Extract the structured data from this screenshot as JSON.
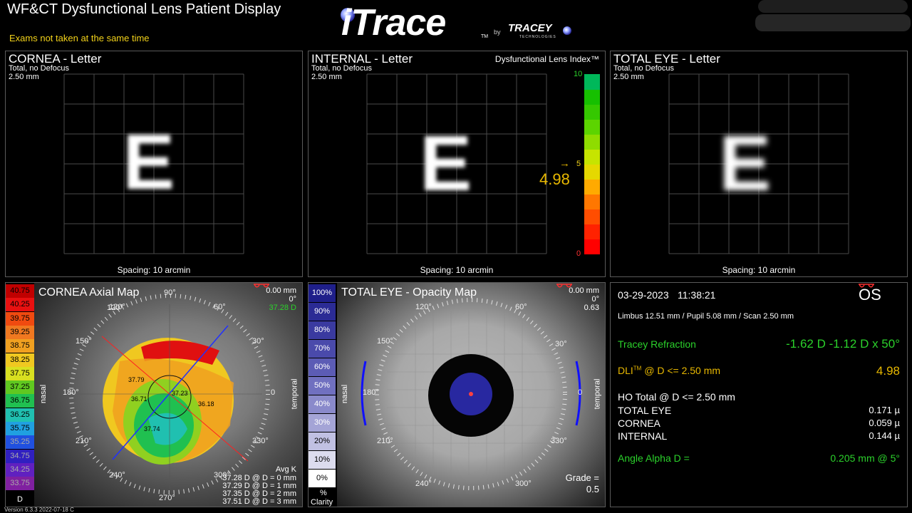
{
  "header": {
    "title": "WF&CT Dysfunctional Lens Patient Display",
    "warning": "Exams not taken at the same time",
    "logo_main": "iTrace",
    "logo_tm": "TM",
    "logo_by": "by",
    "logo_brand": "TRACEY",
    "logo_brand_sub": "TECHNOLOGIES"
  },
  "panels": {
    "cornea_letter": {
      "title": "CORNEA - Letter",
      "sub1": "Total, no Defocus",
      "sub2": "2.50 mm",
      "letter": "E",
      "spacing": "Spacing:  10 arcmin"
    },
    "internal_letter": {
      "title": "INTERNAL - Letter",
      "sub1": "Total, no Defocus",
      "sub2": "2.50 mm",
      "letter": "E",
      "spacing": "Spacing:  10 arcmin",
      "dli_title": "Dysfunctional Lens Index™",
      "dli_value": "4.98",
      "dli_max": "10",
      "dli_mid": "5",
      "dli_min": "0",
      "arrow": "→",
      "dli_scale_colors": [
        "#ff0000",
        "#ff2200",
        "#ff4d00",
        "#ff7700",
        "#ffaa00",
        "#e5d800",
        "#c6e400",
        "#8fdc00",
        "#5cd400",
        "#35c800",
        "#16c000",
        "#00b85a"
      ]
    },
    "total_letter": {
      "title": "TOTAL EYE - Letter",
      "sub1": "Total, no Defocus",
      "sub2": "2.50 mm",
      "letter": "E",
      "spacing": "Spacing:  10 arcmin"
    },
    "axial": {
      "title": "CORNEA  Axial Map",
      "deg90": "90°",
      "info1": "0.00 mm",
      "info2": "0°",
      "info3": "37.28 D",
      "nasal": "nasal",
      "temporal": "temporal",
      "unit": "D",
      "scale": [
        {
          "v": "40.75",
          "c": "#c00000"
        },
        {
          "v": "40.25",
          "c": "#e81010"
        },
        {
          "v": "39.75",
          "c": "#f04a10"
        },
        {
          "v": "39.25",
          "c": "#f07820"
        },
        {
          "v": "38.75",
          "c": "#f0a020"
        },
        {
          "v": "38.25",
          "c": "#f0c820"
        },
        {
          "v": "37.75",
          "c": "#d8e020"
        },
        {
          "v": "37.25",
          "c": "#60c820"
        },
        {
          "v": "36.75",
          "c": "#20c050"
        },
        {
          "v": "36.25",
          "c": "#20c0b0"
        },
        {
          "v": "35.75",
          "c": "#20a0e0"
        },
        {
          "v": "35.25",
          "c": "#2050e0"
        },
        {
          "v": "34.75",
          "c": "#3020c0"
        },
        {
          "v": "34.25",
          "c": "#6020c0"
        },
        {
          "v": "33.75",
          "c": "#8020a0"
        }
      ],
      "angles": [
        "120°",
        "60°",
        "150°",
        "30°",
        "180°",
        "0",
        "210°",
        "330°",
        "240°",
        "300°",
        "270°"
      ],
      "map_labels": [
        "37.79",
        "37.23",
        "36.71",
        "36.18",
        "37.74"
      ],
      "avgk_title": "Avg K",
      "avgk": [
        "37.28 D @ D = 0 mm",
        "37.29 D @ D = 1 mm",
        "37.35 D @ D = 2 mm",
        "37.51 D @ D = 3 mm"
      ]
    },
    "opacity": {
      "title": "TOTAL EYE - Opacity Map",
      "info1": "0.00 mm",
      "info2": "0°",
      "info3": "0.63",
      "nasal": "nasal",
      "temporal": "temporal",
      "scale": [
        {
          "v": "100%",
          "c": "#1f1f8a"
        },
        {
          "v": "90%",
          "c": "#2b2b95"
        },
        {
          "v": "80%",
          "c": "#3a3aa0"
        },
        {
          "v": "70%",
          "c": "#4a4aab"
        },
        {
          "v": "60%",
          "c": "#5c5cb5"
        },
        {
          "v": "50%",
          "c": "#7070c0"
        },
        {
          "v": "40%",
          "c": "#8a8acb"
        },
        {
          "v": "30%",
          "c": "#a4a4d6"
        },
        {
          "v": "20%",
          "c": "#c0c0e2"
        },
        {
          "v": "10%",
          "c": "#dcdcee"
        },
        {
          "v": "0%",
          "c": "#ffffff"
        }
      ],
      "unit1": "%",
      "unit2": "Clarity",
      "angles": [
        "120°",
        "60°",
        "150°",
        "30°",
        "180°",
        "0",
        "210°",
        "330°",
        "240°",
        "300°"
      ],
      "grade_label": "Grade =",
      "grade_value": "0.5"
    },
    "results": {
      "date": "03-29-2023",
      "time": "11:38:21",
      "eye": "OS",
      "measurements": "Limbus 12.51 mm  /  Pupil 5.08 mm  /  Scan 2.50 mm",
      "refraction_label": "Tracey Refraction",
      "refraction_value": "-1.62 D -1.12 D x 50°",
      "dli_label_a": "DLI",
      "dli_label_tm": "TM",
      "dli_label_b": " @ D <= 2.50 mm",
      "dli_value": "4.98",
      "ho_title": "HO Total @ D <= 2.50 mm",
      "ho_rows": [
        {
          "label": "TOTAL EYE",
          "value": "0.171 µ"
        },
        {
          "label": "CORNEA",
          "value": "0.059 µ"
        },
        {
          "label": "INTERNAL",
          "value": "0.144 µ"
        }
      ],
      "alpha_label": "Angle Alpha  D =",
      "alpha_value": "0.205 mm @ 5°"
    }
  },
  "footer": {
    "version": "Version 6.3.3 2022-07-18 C"
  },
  "colors": {
    "yellow": "#f2d21a",
    "green": "#2bd12b",
    "gold": "#e8b800"
  }
}
